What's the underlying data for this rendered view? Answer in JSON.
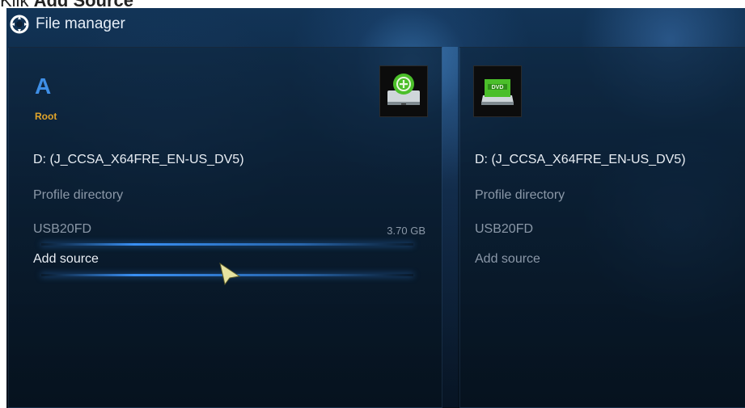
{
  "caption": {
    "prefix": "Klik ",
    "bold": "Add Source"
  },
  "header": {
    "title": "File manager"
  },
  "left_panel": {
    "drive_letter": "A",
    "drive_label": "Root",
    "items": [
      {
        "label": "D: (J_CCSA_X64FRE_EN-US_DV5)",
        "size": ""
      },
      {
        "label": "Profile directory",
        "size": ""
      },
      {
        "label": "USB20FD",
        "size": "3.70 GB"
      },
      {
        "label": "Add source",
        "size": ""
      }
    ]
  },
  "right_panel": {
    "items": [
      {
        "label": "D: (J_CCSA_X64FRE_EN-US_DV5)"
      },
      {
        "label": "Profile directory"
      },
      {
        "label": "USB20FD"
      },
      {
        "label": "Add source"
      }
    ]
  },
  "colors": {
    "accent_blue": "#3f8fe6",
    "label_orange": "#e2a52a",
    "icon_green": "#4bbf2a"
  }
}
